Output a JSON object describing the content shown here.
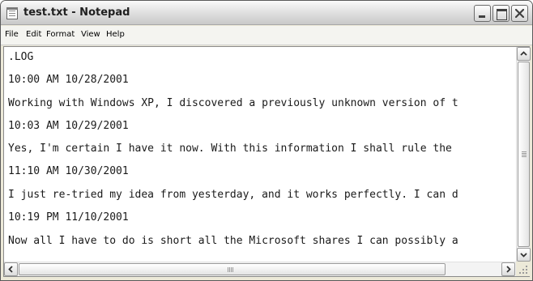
{
  "window": {
    "title": "test.txt - Notepad"
  },
  "icons": {
    "app": "notepad-icon",
    "minimize": "minimize-icon",
    "maximize": "maximize-icon",
    "close": "close-icon",
    "scroll_up": "arrow-up-icon",
    "scroll_down": "arrow-down-icon",
    "scroll_left": "arrow-left-icon",
    "scroll_right": "arrow-right-icon",
    "resize_grip": "resize-grip-icon"
  },
  "menu": {
    "items": [
      "File",
      "Edit",
      "Format",
      "View",
      "Help"
    ]
  },
  "document": {
    "lines": [
      ".LOG",
      "10:00 AM 10/28/2001",
      "Working with Windows XP, I discovered a previously unknown version of t",
      "10:03 AM 10/29/2001",
      "Yes, I'm certain I have it now. With this information I shall rule the",
      "11:10 AM 10/30/2001",
      "I just re-tried my idea from yesterday, and it works perfectly. I can d",
      "10:19 PM 11/10/2001",
      "Now all I have to do is short all the Microsoft shares I can possibly a"
    ]
  }
}
